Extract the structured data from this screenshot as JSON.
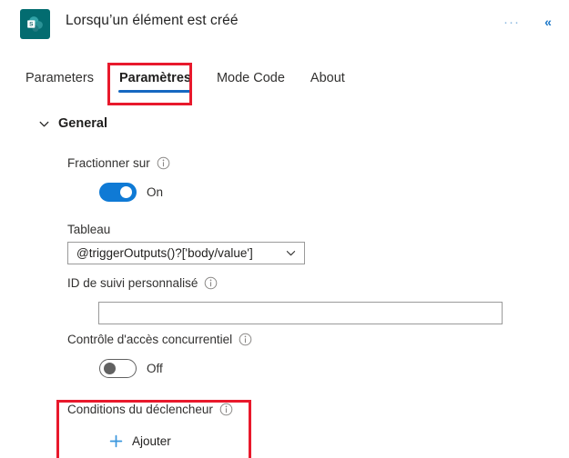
{
  "header": {
    "title": "Lorsqu’un élément est créé",
    "app_icon_name": "sharepoint-icon",
    "more_label": "···",
    "collapse_label": "«"
  },
  "tabs": [
    {
      "label": "Parameters",
      "active": false
    },
    {
      "label": "Paramètres",
      "active": true
    },
    {
      "label": "Mode Code",
      "active": false
    },
    {
      "label": "About",
      "active": false
    }
  ],
  "section": {
    "title": "General",
    "expanded": true
  },
  "fields": {
    "split_on": {
      "label": "Fractionner sur",
      "toggle_state": "On",
      "toggle_on": true
    },
    "array": {
      "label": "Tableau",
      "value": "@triggerOutputs()?['body/value']",
      "placeholder": ""
    },
    "custom_tracking_id": {
      "label": "ID de suivi personnalisé",
      "value": "",
      "placeholder": ""
    },
    "concurrency_control": {
      "label": "Contrôle d'accès concurrentiel",
      "toggle_state": "Off",
      "toggle_on": false
    },
    "trigger_conditions": {
      "label": "Conditions du déclencheur",
      "add_label": "Ajouter"
    }
  },
  "colors": {
    "accent_blue": "#0f7ad5",
    "tab_underline": "#1668c1",
    "highlight_red": "#e8192c",
    "app_icon_teal": "#036c70",
    "add_plus_blue": "#3a96dd"
  }
}
